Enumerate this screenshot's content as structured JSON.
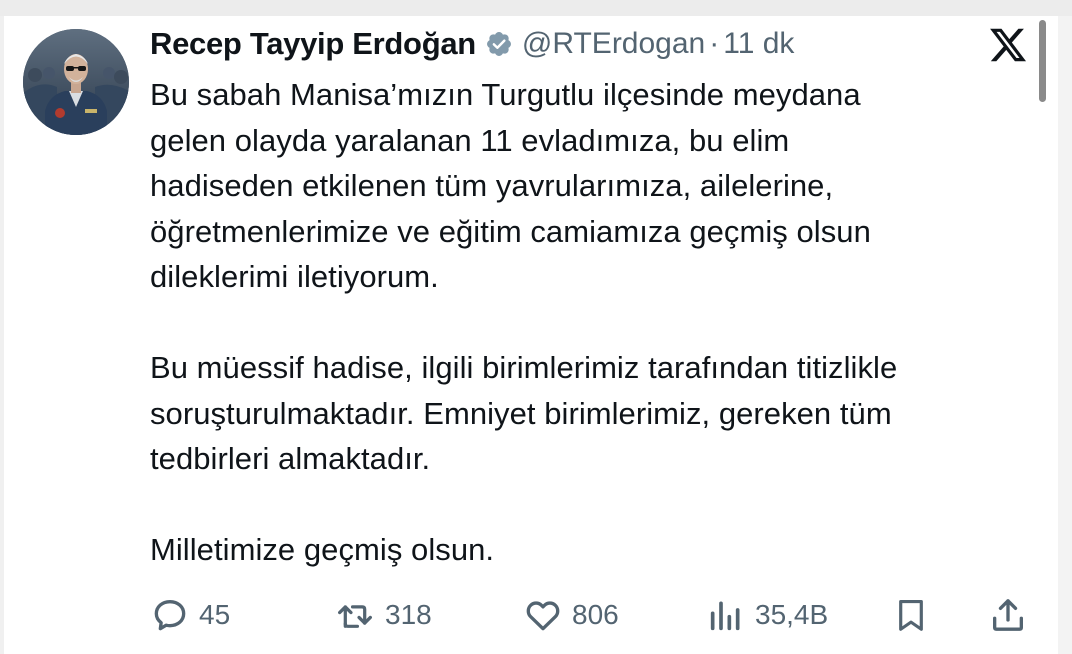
{
  "tweet": {
    "author_name": "Recep Tayyip Erdoğan",
    "handle": "@RTErdogan",
    "separator": "·",
    "time": "11 dk",
    "paragraphs": [
      [
        "Bu sabah Manisa’mızın Turgutlu ilçesinde meydana",
        "gelen olayda yaralanan 11 evladımıza, bu elim",
        "hadiseden etkilenen tüm yavrularımıza, ailelerine,",
        "öğretmenlerimize ve eğitim camiamıza geçmiş olsun",
        "dileklerimi iletiyorum."
      ],
      [
        "Bu müessif hadise, ilgili birimlerimiz tarafından titizlikle",
        "soruşturulmaktadır. Emniyet birimlerimiz, gereken tüm",
        "tedbirleri almaktadır."
      ],
      [
        "Milletimize geçmiş olsun."
      ]
    ]
  },
  "actions": {
    "replies": "45",
    "reposts": "318",
    "likes": "806",
    "views": "35,4B"
  },
  "icons": {
    "verified": "verified-badge-icon",
    "logo": "x-logo-icon",
    "reply": "reply-icon",
    "repost": "repost-icon",
    "like": "heart-icon",
    "views": "views-icon",
    "bookmark": "bookmark-icon",
    "share": "share-icon"
  },
  "colors": {
    "text": "#0f1419",
    "secondary": "#536471",
    "verified_badge": "#829aab"
  }
}
